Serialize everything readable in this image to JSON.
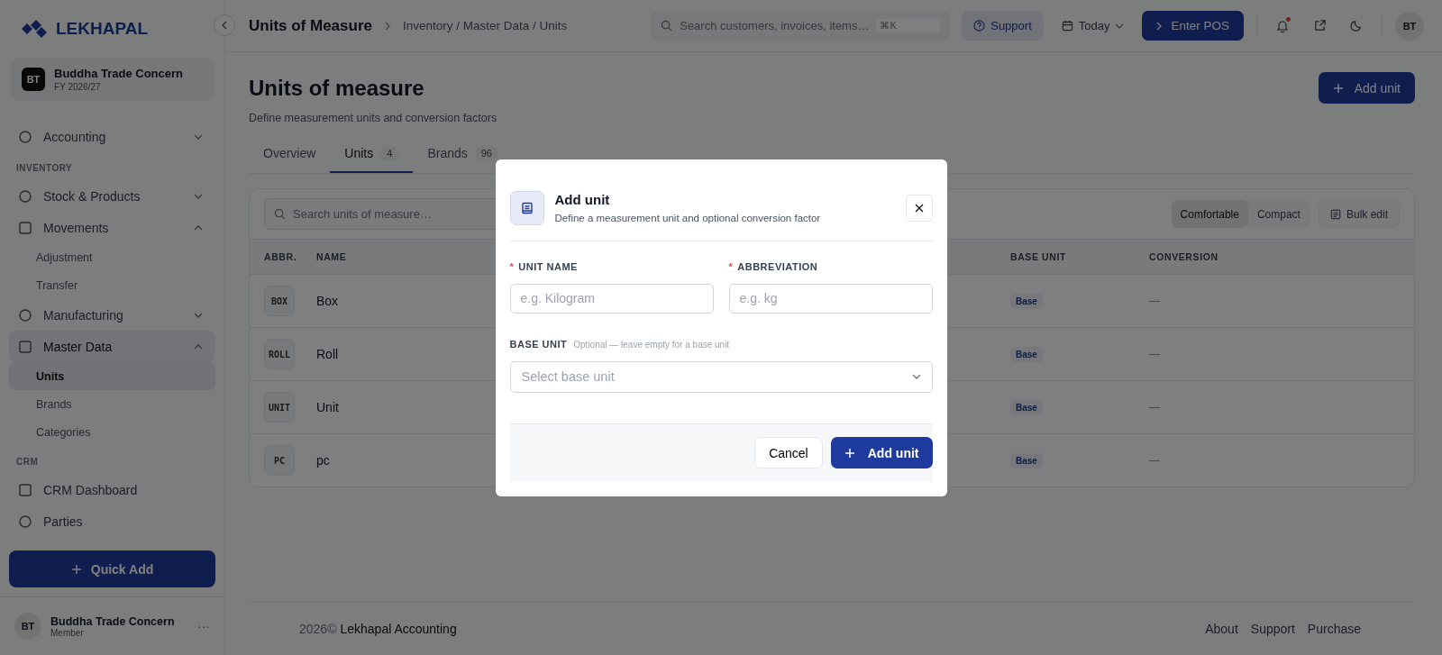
{
  "brand": {
    "name": "LEKHAPAL"
  },
  "sidebar": {
    "company": {
      "initials": "BT",
      "name": "Buddha Trade Concern",
      "fy": "FY 2026/27"
    },
    "items": [
      {
        "kind": "group",
        "label": "Accounting",
        "expanded": false,
        "selected": false
      },
      {
        "kind": "heading",
        "label": "INVENTORY"
      },
      {
        "kind": "group",
        "label": "Stock & Products",
        "expanded": false,
        "selected": false
      },
      {
        "kind": "group",
        "label": "Movements",
        "expanded": true,
        "selected": false,
        "children": [
          {
            "label": "Adjustment",
            "selected": false
          },
          {
            "label": "Transfer",
            "selected": false
          }
        ]
      },
      {
        "kind": "group",
        "label": "Manufacturing",
        "expanded": false,
        "selected": false
      },
      {
        "kind": "group",
        "label": "Master Data",
        "expanded": true,
        "selected": true,
        "children": [
          {
            "label": "Units",
            "selected": true
          },
          {
            "label": "Brands",
            "selected": false
          },
          {
            "label": "Categories",
            "selected": false
          }
        ]
      },
      {
        "kind": "heading",
        "label": "CRM"
      },
      {
        "kind": "link",
        "label": "CRM Dashboard",
        "selected": false
      },
      {
        "kind": "link",
        "label": "Parties",
        "selected": false
      }
    ],
    "quick_add": "Quick Add",
    "user": {
      "initials": "BT",
      "name": "Buddha Trade Concern",
      "role": "Member",
      "menu": "···"
    }
  },
  "header": {
    "title": "Units of Measure",
    "breadcrumb": "Inventory / Master Data / Units",
    "search_placeholder": "Search customers, invoices, items…",
    "shortcut": "⌘K",
    "support": "Support",
    "date": "Today",
    "pos": "Enter POS",
    "has_unread": true,
    "avatar": "BT"
  },
  "page": {
    "title": "Units of measure",
    "subtitle": "Define measurement units and conversion factors",
    "add_button": "Add unit",
    "tabs": [
      {
        "label": "Overview",
        "selected": false
      },
      {
        "label": "Units",
        "count": "4",
        "selected": true
      },
      {
        "label": "Brands",
        "count": "96",
        "selected": false
      }
    ],
    "search_placeholder": "Search units of measure…",
    "density": [
      {
        "label": "Comfortable",
        "selected": true
      },
      {
        "label": "Compact",
        "selected": false
      }
    ],
    "bulk_edit": "Bulk edit",
    "table": {
      "columns": [
        "ABBR.",
        "NAME",
        "BASE UNIT",
        "CONVERSION"
      ],
      "rows": [
        {
          "abbr": "BOX",
          "name": "Box",
          "base": "Base",
          "conversion": "—"
        },
        {
          "abbr": "ROLL",
          "name": "Roll",
          "base": "Base",
          "conversion": "—"
        },
        {
          "abbr": "UNIT",
          "name": "Unit",
          "base": "Base",
          "conversion": "—"
        },
        {
          "abbr": "PC",
          "name": "pc",
          "base": "Base",
          "conversion": "—"
        }
      ]
    }
  },
  "footer": {
    "year": "2026©",
    "name": "Lekhapal Accounting",
    "links": [
      "About",
      "Support",
      "Purchase"
    ]
  },
  "modal": {
    "title": "Add unit",
    "subtitle": "Define a measurement unit and optional conversion factor",
    "required_mark": "*",
    "fields": [
      {
        "label": "UNIT NAME",
        "required": true,
        "placeholder": "e.g. Kilogram"
      },
      {
        "label": "ABBREVIATION",
        "required": true,
        "placeholder": "e.g. kg"
      }
    ],
    "base_unit": {
      "label": "BASE UNIT",
      "hint": "Optional — leave empty for a base unit",
      "placeholder": "Select base unit"
    },
    "cancel": "Cancel",
    "submit": "Add unit"
  }
}
